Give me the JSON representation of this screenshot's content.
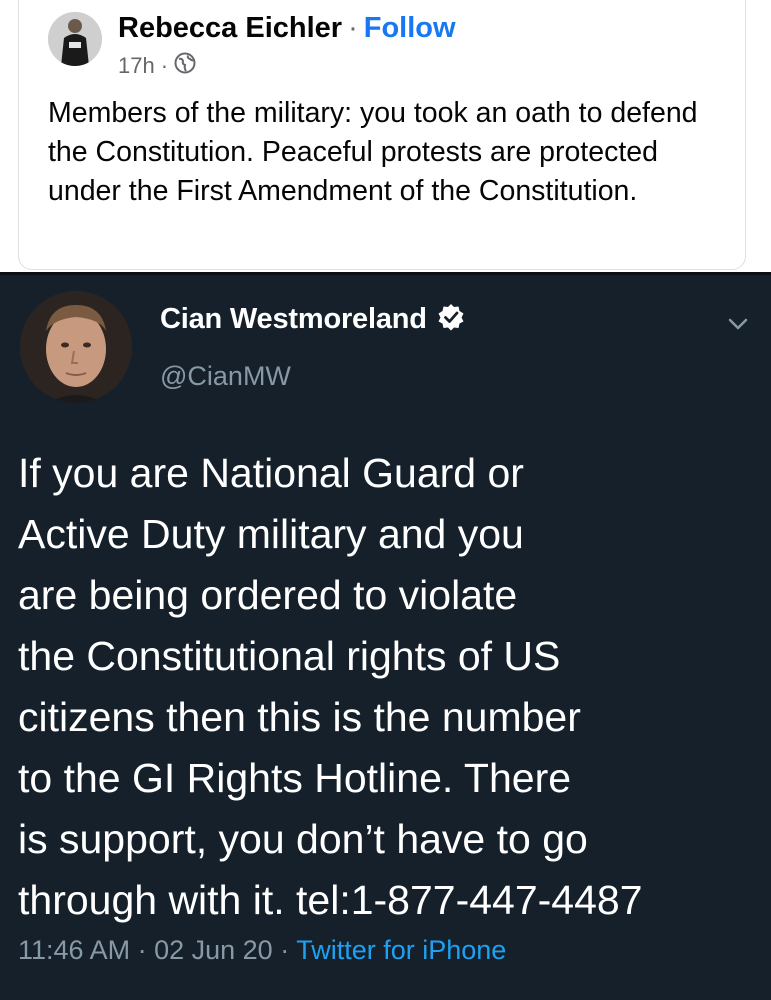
{
  "facebook_post": {
    "author": "Rebecca Eichler",
    "separator": "·",
    "follow_label": "Follow",
    "time": "17h",
    "meta_separator": "·",
    "privacy_icon": "globe-icon",
    "text": "Members of the military: you took an oath to defend the Constitution. Peaceful protests are protected under the First Amendment of the Constitution."
  },
  "tweet": {
    "display_name": "Cian Westmoreland",
    "verified_icon": "verified-badge-icon",
    "handle": "@CianMW",
    "menu_icon": "chevron-down-icon",
    "text_lines": [
      "If you are National Guard or",
      "Active Duty military and you",
      "are being ordered to violate",
      "the Constitutional rights of US",
      "citizens then this is the number",
      "to the GI Rights Hotline. There",
      "is support, you don’t have to go",
      "through with it. tel:1-877-447-4487"
    ],
    "time": "11:46 AM",
    "sep1": " · ",
    "date": "02 Jun 20",
    "sep2": " · ",
    "source": "Twitter for iPhone"
  },
  "colors": {
    "facebook_link": "#1877f2",
    "tweet_background": "#15202b",
    "tweet_secondary_text": "#8899a6",
    "twitter_link": "#1da1f2"
  }
}
